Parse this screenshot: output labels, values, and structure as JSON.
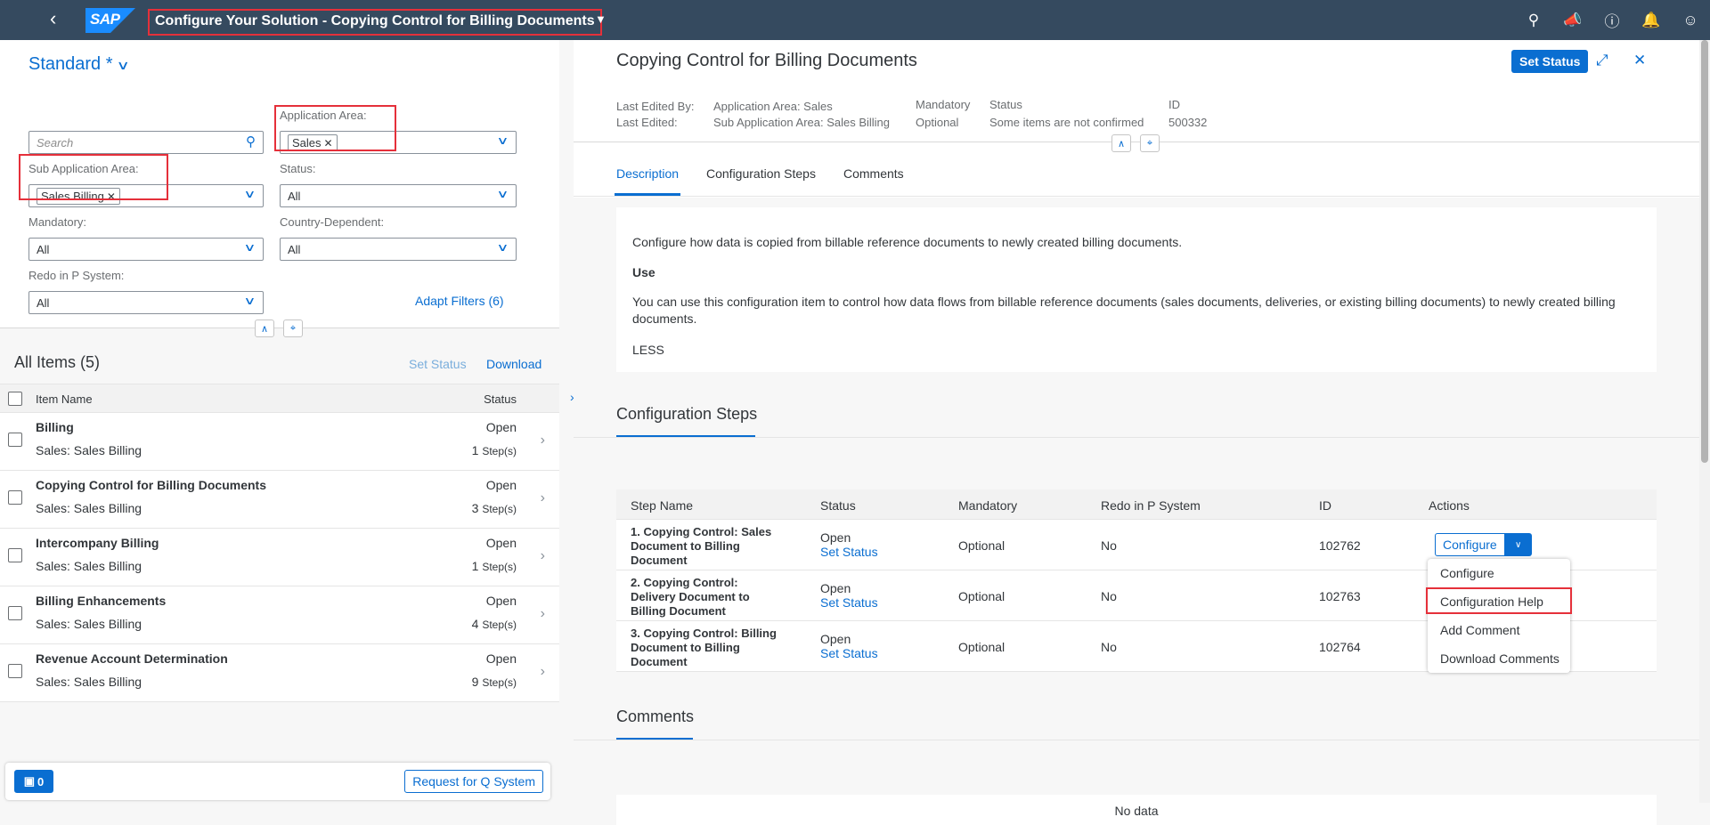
{
  "shell": {
    "title": "Configure Your Solution - Copying Control for Billing Documents",
    "logo": "SAP",
    "icons": [
      "search-icon",
      "megaphone-icon",
      "help-icon",
      "bell-icon",
      "user-icon"
    ]
  },
  "filterbar": {
    "variant": "Standard *",
    "search_placeholder": "Search",
    "application_area": {
      "label": "Application Area:",
      "token": "Sales"
    },
    "sub_application_area": {
      "label": "Sub Application Area:",
      "token": "Sales Billing"
    },
    "status": {
      "label": "Status:",
      "value": "All"
    },
    "mandatory": {
      "label": "Mandatory:",
      "value": "All"
    },
    "country_dependent": {
      "label": "Country-Dependent:",
      "value": "All"
    },
    "redo": {
      "label": "Redo in P System:",
      "value": "All"
    },
    "adapt_filters": "Adapt Filters (6)"
  },
  "list": {
    "title": "All Items (5)",
    "set_status": "Set Status",
    "download": "Download",
    "col_item": "Item Name",
    "col_status": "Status",
    "items": [
      {
        "name": "Billing",
        "sub": "Sales: Sales Billing",
        "status": "Open",
        "steps": "1",
        "steps_unit": "Step(s)"
      },
      {
        "name": "Copying Control for Billing Documents",
        "sub": "Sales: Sales Billing",
        "status": "Open",
        "steps": "3",
        "steps_unit": "Step(s)"
      },
      {
        "name": "Intercompany Billing",
        "sub": "Sales: Sales Billing",
        "status": "Open",
        "steps": "1",
        "steps_unit": "Step(s)"
      },
      {
        "name": "Billing Enhancements",
        "sub": "Sales: Sales Billing",
        "status": "Open",
        "steps": "4",
        "steps_unit": "Step(s)"
      },
      {
        "name": "Revenue Account Determination",
        "sub": "Sales: Sales Billing",
        "status": "Open",
        "steps": "9",
        "steps_unit": "Step(s)"
      }
    ]
  },
  "footer": {
    "messages": "0",
    "request_q": "Request for Q System"
  },
  "detail": {
    "title": "Copying Control for Billing Documents",
    "set_status": "Set Status",
    "last_edited_by_label": "Last Edited By:",
    "last_edited_label": "Last Edited:",
    "app_area": "Application Area: Sales",
    "sub_app_area": "Sub Application Area: Sales Billing",
    "mandatory_label": "Mandatory",
    "mandatory_value": "Optional",
    "status_label": "Status",
    "status_value": "Some items are not confirmed",
    "id_label": "ID",
    "id_value": "500332",
    "tabs": [
      "Description",
      "Configuration Steps",
      "Comments"
    ],
    "description": {
      "p1": "Configure how data is copied from billable reference documents to newly created billing documents.",
      "use": "Use",
      "p2": "You can use this configuration item to control how data flows from billable reference documents (sales documents, deliveries, or existing billing documents) to newly created billing documents.",
      "less": "LESS"
    },
    "steps_title": "Configuration Steps",
    "steps_cols": [
      "Step Name",
      "Status",
      "Mandatory",
      "Redo in P System",
      "ID",
      "Actions"
    ],
    "steps": [
      {
        "name": "1. Copying Control: Sales Document to Billing Document",
        "status": "Open",
        "set_status": "Set Status",
        "mandatory": "Optional",
        "redo": "No",
        "id": "102762"
      },
      {
        "name": "2. Copying Control: Delivery Document to Billing Document",
        "status": "Open",
        "set_status": "Set Status",
        "mandatory": "Optional",
        "redo": "No",
        "id": "102763"
      },
      {
        "name": "3. Copying Control: Billing Document to Billing Document",
        "status": "Open",
        "set_status": "Set Status",
        "mandatory": "Optional",
        "redo": "No",
        "id": "102764"
      }
    ],
    "configure_btn": "Configure",
    "menu": [
      "Configure",
      "Configuration Help",
      "Add Comment",
      "Download Comments"
    ],
    "comments_title": "Comments",
    "no_data": "No data"
  },
  "colors": {
    "shell": "#354a5f",
    "accent": "#0a6ed1",
    "highlight": "#e5303a"
  }
}
